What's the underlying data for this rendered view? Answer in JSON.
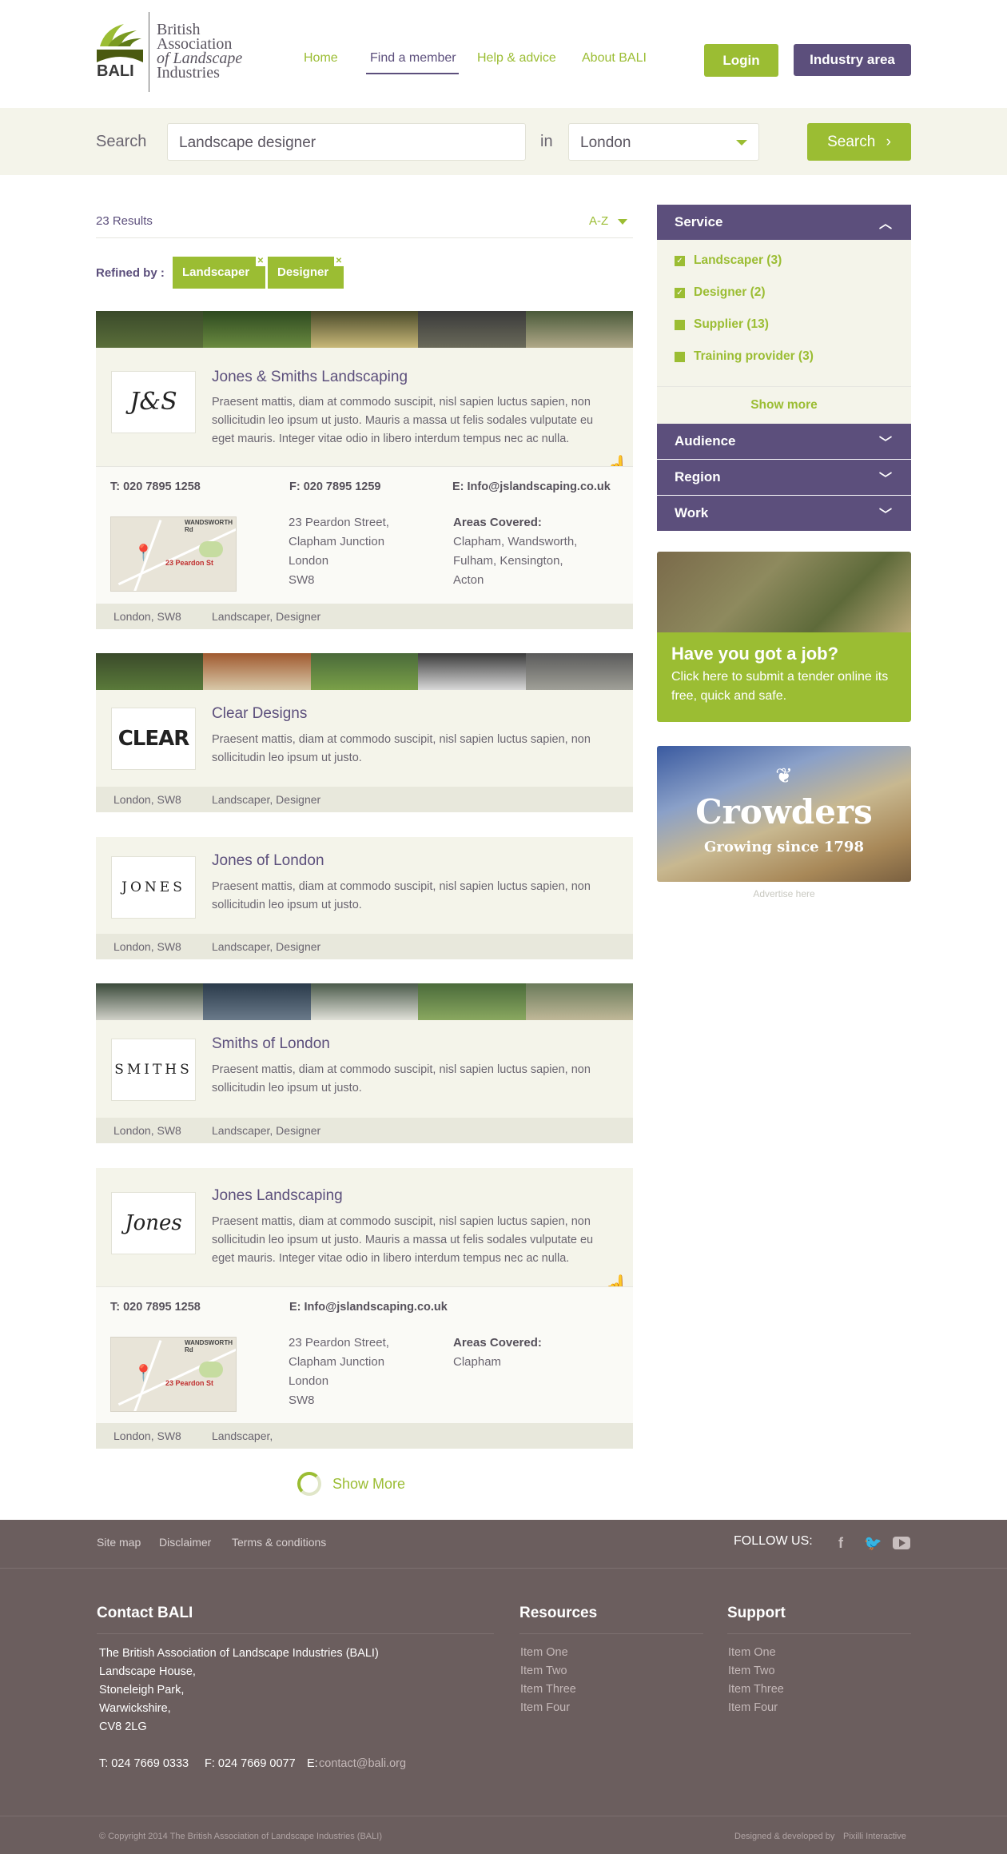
{
  "header": {
    "logo_lines": [
      "British",
      "Association",
      "of Landscape",
      "Industries"
    ],
    "logo_mark": "BALI",
    "nav": [
      "Home",
      "Find a member",
      "Help & advice",
      "About BALI"
    ],
    "login": "Login",
    "industry": "Industry area",
    "colors": {
      "green": "#9bbd33",
      "purple": "#5c4f7c"
    }
  },
  "search": {
    "label": "Search",
    "query": "Landscape designer",
    "in": "in",
    "location": "London",
    "button": "Search"
  },
  "results": {
    "count": "23 Results",
    "sort": "A-Z",
    "refined_label": "Refined by :",
    "tags": [
      "Landscaper",
      "Designer"
    ],
    "show_more": "Show More",
    "items": [
      {
        "logo": "J&S",
        "name": "Jones & Smiths Landscaping",
        "desc": "Praesent mattis, diam at commodo suscipit, nisl sapien luctus sapien, non sollicitudin leo ipsum ut justo. Mauris a massa ut felis sodales vulputate eu eget mauris. Integer vitae odio in libero interdum tempus nec ac nulla.",
        "tel": "T: 020 7895 1258",
        "fax": "F: 020 7895 1259",
        "email": "E: Info@jslandscaping.co.uk",
        "address": [
          "23 Peardon Street,",
          "Clapham Junction",
          "London",
          "SW8"
        ],
        "areas_label": "Areas Covered:",
        "areas": [
          "Clapham, Wandsworth,",
          "Fulham, Kensington,",
          "Acton"
        ],
        "map_label": "23 Peardon St",
        "map_road": "WANDSWORTH Rd",
        "location": "London, SW8",
        "categories": "Landscaper, Designer"
      },
      {
        "logo": "CLEAR",
        "name": "Clear Designs",
        "desc": "Praesent mattis, diam at commodo suscipit, nisl sapien luctus sapien, non sollicitudin leo ipsum ut justo.",
        "location": "London, SW8",
        "categories": "Landscaper, Designer"
      },
      {
        "logo": "JONES",
        "name": "Jones of London",
        "desc": "Praesent mattis, diam at commodo suscipit, nisl sapien luctus sapien, non sollicitudin leo ipsum ut justo.",
        "location": "London, SW8",
        "categories": "Landscaper, Designer"
      },
      {
        "logo": "SMITHS",
        "name": "Smiths of London",
        "desc": "Praesent mattis, diam at commodo suscipit, nisl sapien luctus sapien, non sollicitudin leo ipsum ut justo.",
        "location": "London, SW8",
        "categories": "Landscaper, Designer"
      },
      {
        "logo": "Jones",
        "name": "Jones Landscaping",
        "desc": "Praesent mattis, diam at commodo suscipit, nisl sapien luctus sapien, non sollicitudin leo ipsum ut justo. Mauris a massa ut felis sodales vulputate eu eget mauris. Integer vitae odio in libero interdum tempus nec ac nulla.",
        "tel": "T: 020 7895 1258",
        "email": "E: Info@jslandscaping.co.uk",
        "address": [
          "23 Peardon Street,",
          "Clapham Junction",
          "London",
          "SW8"
        ],
        "areas_label": "Areas Covered:",
        "areas": [
          "Clapham"
        ],
        "map_label": "23 Peardon St",
        "map_road": "WANDSWORTH Rd",
        "location": "London, SW8",
        "categories": "Landscaper,"
      }
    ]
  },
  "sidebar": {
    "service": "Service",
    "service_items": [
      {
        "label": "Landscaper (3)",
        "checked": true
      },
      {
        "label": "Designer (2)",
        "checked": true
      },
      {
        "label": "Supplier (13)",
        "checked": false
      },
      {
        "label": "Training provider (3)",
        "checked": false
      }
    ],
    "show_more": "Show more",
    "audience": "Audience",
    "region": "Region",
    "work": "Work",
    "promo_title": "Have you got a job?",
    "promo_text": "Click here to submit a tender online its free, quick and safe.",
    "ad_title": "Crowders",
    "ad_sub": "Growing since 1798",
    "ad_label": "Advertise here"
  },
  "footer": {
    "links": [
      "Site map",
      "Disclaimer",
      "Terms & conditions"
    ],
    "follow": "FOLLOW US:",
    "contact_title": "Contact BALI",
    "contact_lines": [
      "The British Association of Landscape Industries (BALI)",
      "Landscape House,",
      "Stoneleigh Park,",
      "Warwickshire,",
      "CV8 2LG"
    ],
    "tel": "T: 024 7669 0333",
    "fax": "F: 024 7669 0077",
    "email_label": "E:",
    "email": "contact@bali.org",
    "resources_title": "Resources",
    "support_title": "Support",
    "items": [
      "Item One",
      "Item Two",
      "Item Three",
      "Item Four"
    ],
    "copyright": "© Copyright 2014 The British Association of Landscape Industries (BALI)",
    "credit": "Designed & developed by",
    "credit_name": "Pixilli Interactive"
  }
}
